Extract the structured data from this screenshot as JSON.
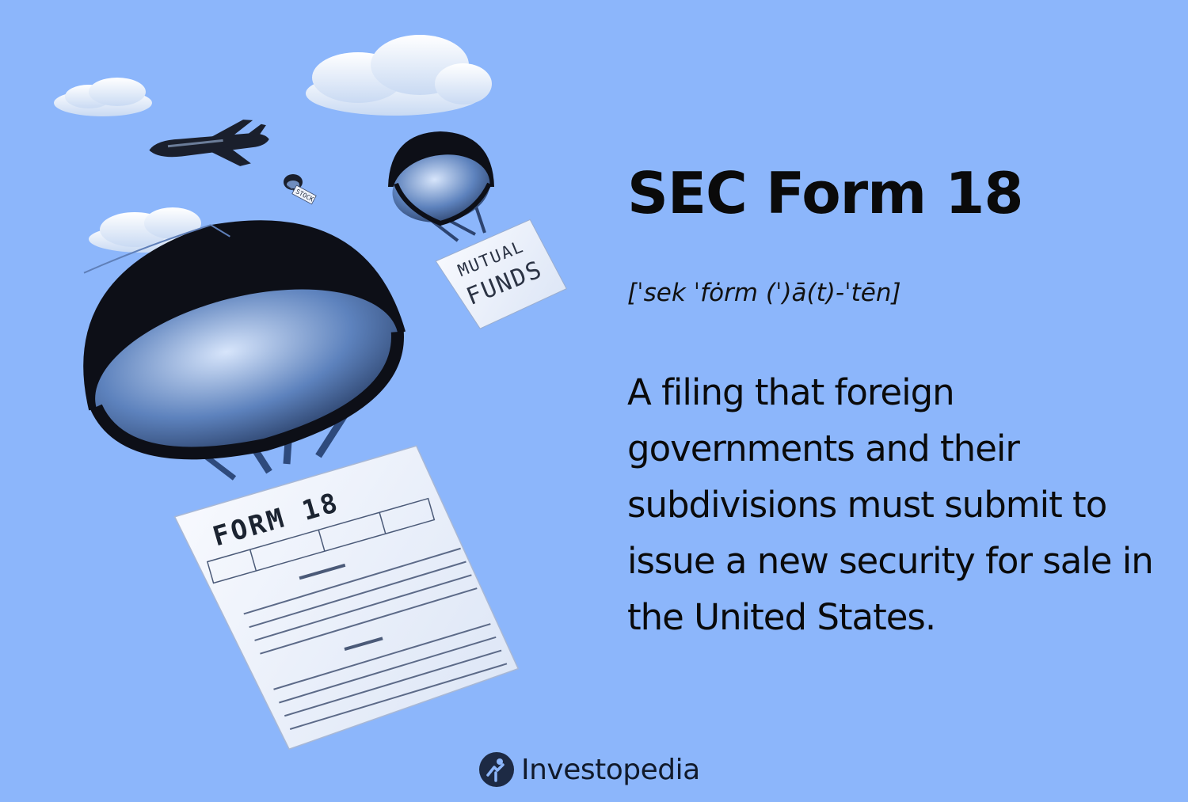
{
  "header": {
    "title": "SEC Form 18",
    "pronunciation": "[ˈsek ˈfȯrm (ˈ)ā(t)-ˈtēn]"
  },
  "definition": {
    "text": "A filing that foreign governments and their subdivisions must submit to issue a new security for sale in the United States."
  },
  "illustration": {
    "main_form_label": "FORM 18",
    "mutual_funds_label_top": "MUTUAL",
    "mutual_funds_label_bottom": "FUNDS",
    "stock_label": "STOCK"
  },
  "brand": {
    "name": "Investopedia",
    "icon": "investopedia-logo-icon"
  },
  "colors": {
    "background": "#8cb6fb",
    "parachute": "#0d0f17",
    "paper": "#eef2fb",
    "text": "#0a0a0a"
  }
}
